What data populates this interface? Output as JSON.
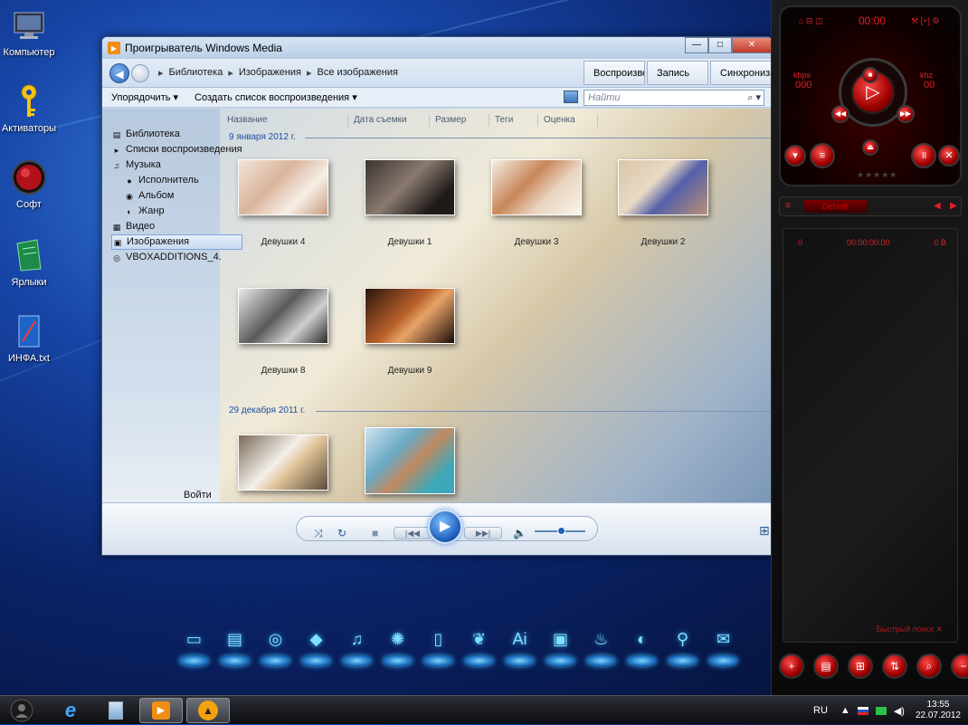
{
  "desktop": {
    "icons": [
      {
        "label": "Компьютер",
        "icon": "monitor-icon"
      },
      {
        "label": "Активаторы",
        "icon": "key-icon"
      },
      {
        "label": "Софт",
        "icon": "red-orb-icon"
      },
      {
        "label": "Ярлыки",
        "icon": "green-folder-icon"
      },
      {
        "label": "ИНФА.txt",
        "icon": "text-file-icon"
      }
    ]
  },
  "wmp": {
    "title": "Проигрыватель Windows Media",
    "breadcrumb": [
      "Библиотека",
      "Изображения",
      "Все изображения"
    ],
    "tabs": [
      "Воспроизведение",
      "Запись",
      "Синхронизация"
    ],
    "toolbar": {
      "organize": "Упорядочить",
      "create_playlist": "Создать список воспроизведения"
    },
    "search_placeholder": "Найти",
    "tree": [
      {
        "label": "Библиотека",
        "level": 0
      },
      {
        "label": "Списки воспроизведения",
        "level": 0
      },
      {
        "label": "Музыка",
        "level": 0
      },
      {
        "label": "Исполнитель",
        "level": 1
      },
      {
        "label": "Альбом",
        "level": 1
      },
      {
        "label": "Жанр",
        "level": 1
      },
      {
        "label": "Видео",
        "level": 0
      },
      {
        "label": "Изображения",
        "level": 0,
        "selected": true
      },
      {
        "label": "VBOXADDITIONS_4.",
        "level": 0
      }
    ],
    "other_libraries": "Войти",
    "columns": [
      "Название",
      "Дата съемки",
      "Размер",
      "Теги",
      "Оценка"
    ],
    "groups": [
      {
        "date": "9 января 2012 г.",
        "items": [
          "Девушки 4",
          "Девушки 1",
          "Девушки 3",
          "Девушки 2",
          "Девушки 8",
          "Девушки 9"
        ]
      },
      {
        "date": "29 декабря 2011 г.",
        "items": [
          "",
          ""
        ]
      }
    ]
  },
  "aimp": {
    "time": "00:00",
    "kbps_label": "kbps",
    "khz_label": "khz",
    "kbps_value": "000",
    "khz_value": "00",
    "preset": "Default",
    "playlist_header": {
      "index": "0",
      "duration": "00:00:00:00",
      "size": "0 B"
    },
    "quick_search": "Быстрый поиск"
  },
  "dock": {
    "items": [
      "monitor-icon",
      "window-icon",
      "chrome-icon",
      "folder-icon",
      "music-icon",
      "film-reel-icon",
      "document-icon",
      "paint-icon",
      "illustrator-icon",
      "floppy-icon",
      "flame-icon",
      "balloon-icon",
      "satellite-icon",
      "mail-icon"
    ]
  },
  "taskbar": {
    "lang": "RU",
    "time": "13:55",
    "date": "22.07.2012"
  }
}
